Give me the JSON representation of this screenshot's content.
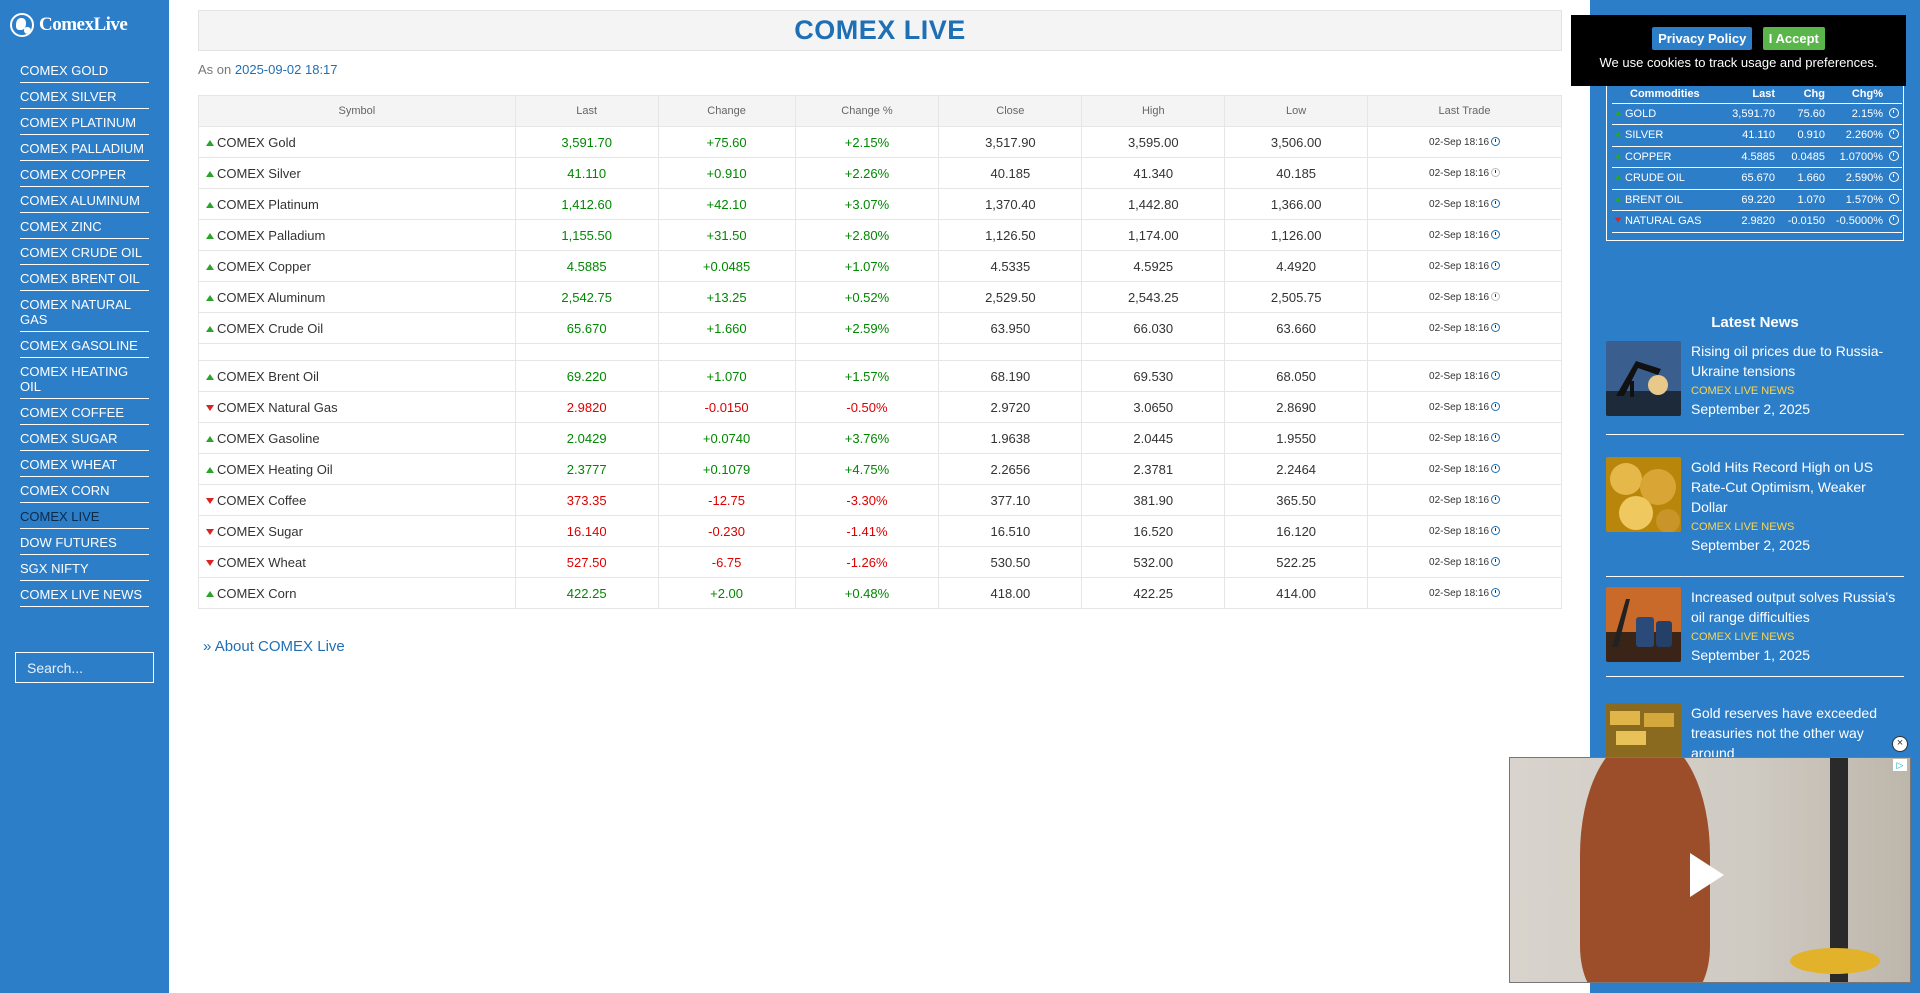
{
  "logo": {
    "text": "ComexLive"
  },
  "nav": [
    "COMEX GOLD",
    "COMEX SILVER",
    "COMEX PLATINUM",
    "COMEX PALLADIUM",
    "COMEX COPPER",
    "COMEX ALUMINUM",
    "COMEX ZINC",
    "COMEX CRUDE OIL",
    "COMEX BRENT OIL",
    "COMEX NATURAL GAS",
    "COMEX GASOLINE",
    "COMEX HEATING OIL",
    "COMEX COFFEE",
    "COMEX SUGAR",
    "COMEX WHEAT",
    "COMEX CORN",
    "COMEX LIVE",
    "DOW FUTURES",
    "SGX NIFTY",
    "COMEX LIVE NEWS"
  ],
  "active_nav": "COMEX LIVE",
  "search": {
    "placeholder": "Search..."
  },
  "page": {
    "title": "COMEX LIVE",
    "as_on_label": "As on",
    "as_on_value": "2025-09-02 18:17",
    "about_link": "About COMEX Live",
    "about_icon": "double-chevron-right-icon"
  },
  "table": {
    "headers": [
      "Symbol",
      "Last",
      "Change",
      "Change %",
      "Close",
      "High",
      "Low",
      "Last Trade"
    ],
    "rows": [
      {
        "symbol": "COMEX Gold",
        "dir": "up",
        "last": "3,591.70",
        "change": "+75.60",
        "pct": "+2.15%",
        "close": "3,517.90",
        "high": "3,595.00",
        "low": "3,506.00",
        "trade": "02-Sep 18:16",
        "clock": "active"
      },
      {
        "symbol": "COMEX Silver",
        "dir": "up",
        "last": "41.110",
        "change": "+0.910",
        "pct": "+2.26%",
        "close": "40.185",
        "high": "41.340",
        "low": "40.185",
        "trade": "02-Sep 18:16",
        "clock": "faint"
      },
      {
        "symbol": "COMEX Platinum",
        "dir": "up",
        "last": "1,412.60",
        "change": "+42.10",
        "pct": "+3.07%",
        "close": "1,370.40",
        "high": "1,442.80",
        "low": "1,366.00",
        "trade": "02-Sep 18:16",
        "clock": "active"
      },
      {
        "symbol": "COMEX Palladium",
        "dir": "up",
        "last": "1,155.50",
        "change": "+31.50",
        "pct": "+2.80%",
        "close": "1,126.50",
        "high": "1,174.00",
        "low": "1,126.00",
        "trade": "02-Sep 18:16",
        "clock": "active"
      },
      {
        "symbol": "COMEX Copper",
        "dir": "up",
        "last": "4.5885",
        "change": "+0.0485",
        "pct": "+1.07%",
        "close": "4.5335",
        "high": "4.5925",
        "low": "4.4920",
        "trade": "02-Sep 18:16",
        "clock": "active"
      },
      {
        "symbol": "COMEX Aluminum",
        "dir": "up",
        "last": "2,542.75",
        "change": "+13.25",
        "pct": "+0.52%",
        "close": "2,529.50",
        "high": "2,543.25",
        "low": "2,505.75",
        "trade": "02-Sep 18:16",
        "clock": "faint"
      },
      {
        "symbol": "COMEX Crude Oil",
        "dir": "up",
        "last": "65.670",
        "change": "+1.660",
        "pct": "+2.59%",
        "close": "63.950",
        "high": "66.030",
        "low": "63.660",
        "trade": "02-Sep 18:16",
        "clock": "active"
      },
      {
        "gap": true
      },
      {
        "symbol": "COMEX Brent Oil",
        "dir": "up",
        "last": "69.220",
        "change": "+1.070",
        "pct": "+1.57%",
        "close": "68.190",
        "high": "69.530",
        "low": "68.050",
        "trade": "02-Sep 18:16",
        "clock": "active"
      },
      {
        "symbol": "COMEX Natural Gas",
        "dir": "down",
        "last": "2.9820",
        "change": "-0.0150",
        "pct": "-0.50%",
        "close": "2.9720",
        "high": "3.0650",
        "low": "2.8690",
        "trade": "02-Sep 18:16",
        "clock": "active"
      },
      {
        "symbol": "COMEX Gasoline",
        "dir": "up",
        "last": "2.0429",
        "change": "+0.0740",
        "pct": "+3.76%",
        "close": "1.9638",
        "high": "2.0445",
        "low": "1.9550",
        "trade": "02-Sep 18:16",
        "clock": "active"
      },
      {
        "symbol": "COMEX Heating Oil",
        "dir": "up",
        "last": "2.3777",
        "change": "+0.1079",
        "pct": "+4.75%",
        "close": "2.2656",
        "high": "2.3781",
        "low": "2.2464",
        "trade": "02-Sep 18:16",
        "clock": "active"
      },
      {
        "symbol": "COMEX Coffee",
        "dir": "down",
        "last": "373.35",
        "change": "-12.75",
        "pct": "-3.30%",
        "close": "377.10",
        "high": "381.90",
        "low": "365.50",
        "trade": "02-Sep 18:16",
        "clock": "active"
      },
      {
        "symbol": "COMEX Sugar",
        "dir": "down",
        "last": "16.140",
        "change": "-0.230",
        "pct": "-1.41%",
        "close": "16.510",
        "high": "16.520",
        "low": "16.120",
        "trade": "02-Sep 18:16",
        "clock": "active"
      },
      {
        "symbol": "COMEX Wheat",
        "dir": "down",
        "last": "527.50",
        "change": "-6.75",
        "pct": "-1.26%",
        "close": "530.50",
        "high": "532.00",
        "low": "522.25",
        "trade": "02-Sep 18:16",
        "clock": "active"
      },
      {
        "symbol": "COMEX Corn",
        "dir": "up",
        "last": "422.25",
        "change": "+2.00",
        "pct": "+0.48%",
        "close": "418.00",
        "high": "422.25",
        "low": "414.00",
        "trade": "02-Sep 18:16",
        "clock": "active"
      }
    ]
  },
  "cookie": {
    "privacy_label": "Privacy Policy",
    "accept_label": "I Accept",
    "message": "We use cookies to track usage and preferences."
  },
  "mini_table": {
    "headers": [
      "Commodities",
      "Last",
      "Chg",
      "Chg%"
    ],
    "rows": [
      {
        "name": "GOLD",
        "dir": "up",
        "last": "3,591.70",
        "chg": "75.60",
        "pct": "2.15%"
      },
      {
        "name": "SILVER",
        "dir": "up",
        "last": "41.110",
        "chg": "0.910",
        "pct": "2.260%"
      },
      {
        "name": "COPPER",
        "dir": "up",
        "last": "4.5885",
        "chg": "0.0485",
        "pct": "1.0700%"
      },
      {
        "name": "CRUDE OIL",
        "dir": "up",
        "last": "65.670",
        "chg": "1.660",
        "pct": "2.590%"
      },
      {
        "name": "BRENT OIL",
        "dir": "up",
        "last": "69.220",
        "chg": "1.070",
        "pct": "1.570%"
      },
      {
        "name": "NATURAL GAS",
        "dir": "down",
        "last": "2.9820",
        "chg": "-0.0150",
        "pct": "-0.5000%"
      }
    ]
  },
  "news": {
    "title": "Latest News",
    "items": [
      {
        "headline": "Rising oil prices due to Russia-Ukraine tensions",
        "source": "COMEX LIVE NEWS",
        "date": "September 2, 2025",
        "image": "oil-pumpjack-image"
      },
      {
        "headline": "Gold Hits Record High on US Rate-Cut Optimism, Weaker Dollar",
        "source": "COMEX LIVE NEWS",
        "date": "September 2, 2025",
        "image": "gold-coins-image"
      },
      {
        "headline": "Increased output solves Russia's oil range difficulties",
        "source": "COMEX LIVE NEWS",
        "date": "September 1, 2025",
        "image": "oil-barrels-image"
      },
      {
        "headline": "Gold reserves have exceeded treasuries not the other way around",
        "source": "",
        "date": "",
        "image": "gold-bars-image"
      }
    ]
  },
  "video_ad": {
    "close_icon": "close-icon",
    "play_icon": "play-icon",
    "adchoices_icon": "adchoices-icon"
  },
  "colors": {
    "sidebar": "#2d7ec9",
    "up": "#008800",
    "down": "#dd0000",
    "title": "#1f6fb4"
  }
}
